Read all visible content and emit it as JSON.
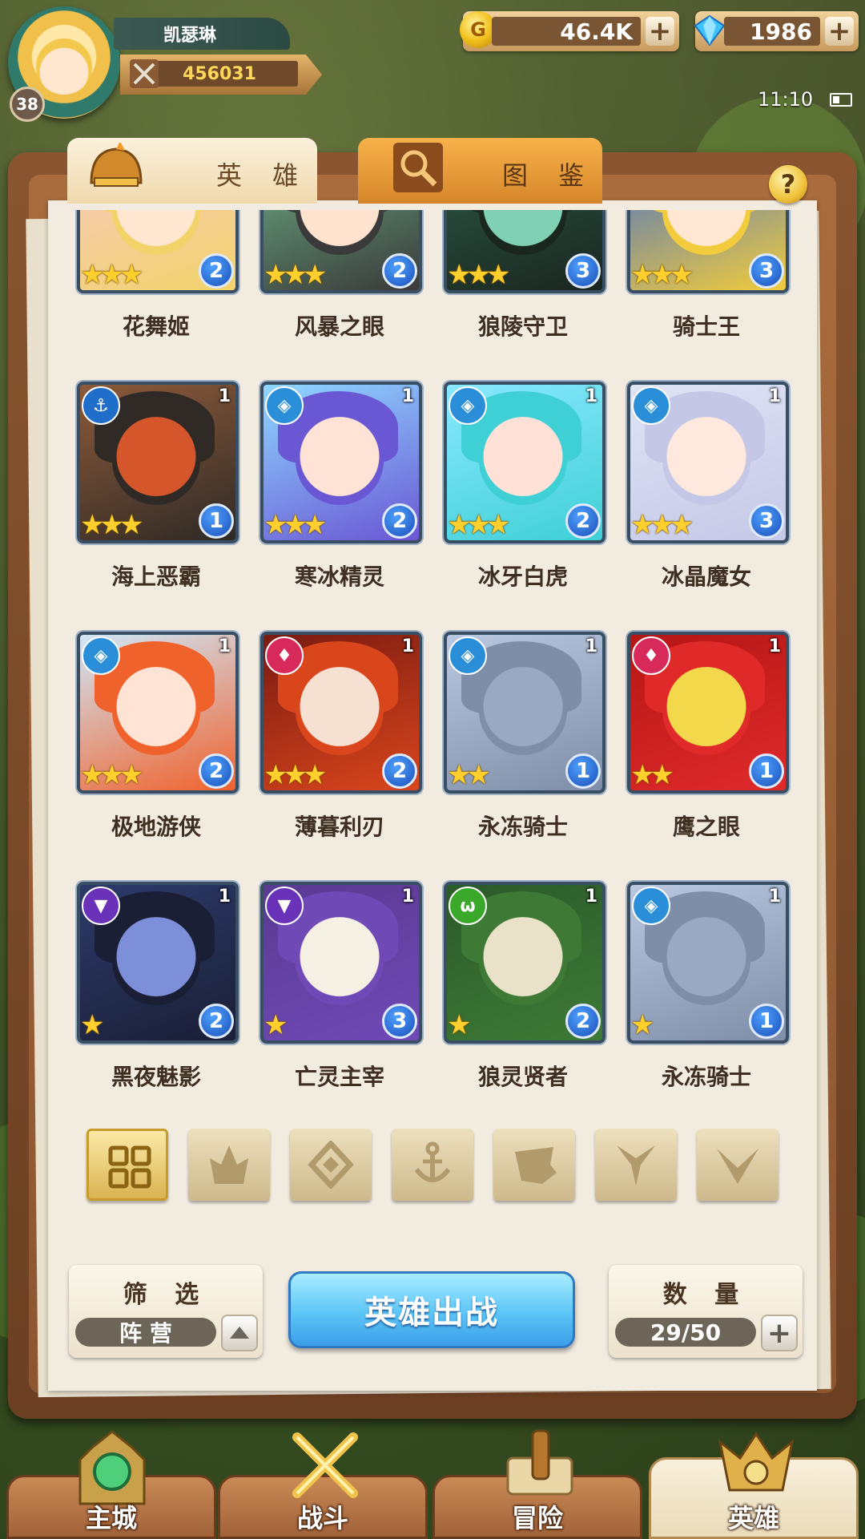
{
  "player": {
    "name": "凯瑟琳",
    "level": "38",
    "power": "456031"
  },
  "currency": {
    "gold": "46.4K",
    "gems": "1986"
  },
  "status": {
    "time": "11:10"
  },
  "tabs": {
    "heroes": "英 雄",
    "codex": "图 鉴"
  },
  "help_label": "?",
  "heroes": [
    {
      "name": "花舞姬",
      "stars": "★★★",
      "level": "2",
      "faction": "",
      "tier": "",
      "colors": [
        "#f6c9c9",
        "#f2d36a",
        "#ffe6d0"
      ]
    },
    {
      "name": "风暴之眼",
      "stars": "★★★",
      "level": "2",
      "faction": "",
      "tier": "",
      "colors": [
        "#6fb38a",
        "#3a3a3a",
        "#ffe3cf"
      ]
    },
    {
      "name": "狼陵守卫",
      "stars": "★★★",
      "level": "3",
      "faction": "",
      "tier": "",
      "colors": [
        "#2d5a48",
        "#1a2620",
        "#7fd0b4"
      ]
    },
    {
      "name": "骑士王",
      "stars": "★★★",
      "level": "3",
      "faction": "",
      "tier": "",
      "colors": [
        "#3b6ad0",
        "#f2cc3c",
        "#ffe7d4"
      ]
    },
    {
      "name": "海上恶霸",
      "stars": "★★★",
      "level": "1",
      "faction": "⚓",
      "tier": "1",
      "colors": [
        "#8c5a3a",
        "#2f2a26",
        "#d5562a"
      ]
    },
    {
      "name": "寒冰精灵",
      "stars": "★★★",
      "level": "2",
      "faction": "◈",
      "tier": "1",
      "colors": [
        "#8fd7ff",
        "#6a57d4",
        "#ffe3d6"
      ]
    },
    {
      "name": "冰牙白虎",
      "stars": "★★★",
      "level": "2",
      "faction": "◈",
      "tier": "1",
      "colors": [
        "#8ae8ff",
        "#3fd0d6",
        "#ffe1d8"
      ]
    },
    {
      "name": "冰晶魔女",
      "stars": "★★★",
      "level": "3",
      "faction": "◈",
      "tier": "1",
      "colors": [
        "#dfe4f5",
        "#c4c8e6",
        "#ffe8dd"
      ]
    },
    {
      "name": "极地游侠",
      "stars": "★★★",
      "level": "2",
      "faction": "◈",
      "tier": "1",
      "colors": [
        "#cfe7f8",
        "#f0622c",
        "#ffe4d5"
      ]
    },
    {
      "name": "薄暮利刃",
      "stars": "★★★",
      "level": "2",
      "faction": "♦",
      "tier": "1",
      "colors": [
        "#7a1a12",
        "#d9461c",
        "#f6e0d2"
      ]
    },
    {
      "name": "永冻骑士",
      "stars": "★★",
      "level": "1",
      "faction": "◈",
      "tier": "1",
      "colors": [
        "#b9c8e0",
        "#7f8ea8",
        "#9aa9c2"
      ]
    },
    {
      "name": "鹰之眼",
      "stars": "★★",
      "level": "1",
      "faction": "♦",
      "tier": "1",
      "colors": [
        "#b51616",
        "#e02a2a",
        "#f2d84a"
      ]
    },
    {
      "name": "黑夜魅影",
      "stars": "★",
      "level": "2",
      "faction": "▼",
      "tier": "1",
      "colors": [
        "#2d3a6a",
        "#1a1f36",
        "#7c8fd8"
      ]
    },
    {
      "name": "亡灵主宰",
      "stars": "★",
      "level": "3",
      "faction": "▼",
      "tier": "1",
      "colors": [
        "#5a3a92",
        "#6f4ab6",
        "#f4f0e4"
      ]
    },
    {
      "name": "狼灵贤者",
      "stars": "★",
      "level": "2",
      "faction": "ω",
      "tier": "1",
      "colors": [
        "#2b5a2a",
        "#3e7a36",
        "#e9e2c8"
      ]
    },
    {
      "name": "永冻骑士",
      "stars": "★",
      "level": "1",
      "faction": "◈",
      "tier": "1",
      "colors": [
        "#b9c8e0",
        "#7f8ea8",
        "#9aa9c2"
      ]
    }
  ],
  "faction_colors": {
    "⚓": "#1f6ec9",
    "◈": "#2a8fd8",
    "♦": "#d82a5a",
    "▼": "#6a32b8",
    "ω": "#3aa82a"
  },
  "filters": [
    "all-icon",
    "flame-icon",
    "ice-icon",
    "anchor-icon",
    "beast-icon",
    "shadow-icon",
    "dark-icon"
  ],
  "panel": {
    "filter_title": "筛 选",
    "filter_value": "阵 营",
    "deploy_label": "英雄出战",
    "count_title": "数 量",
    "count_value": "29/50"
  },
  "nav": {
    "main_city": "主城",
    "battle": "战斗",
    "adventure": "冒险",
    "heroes": "英雄"
  }
}
